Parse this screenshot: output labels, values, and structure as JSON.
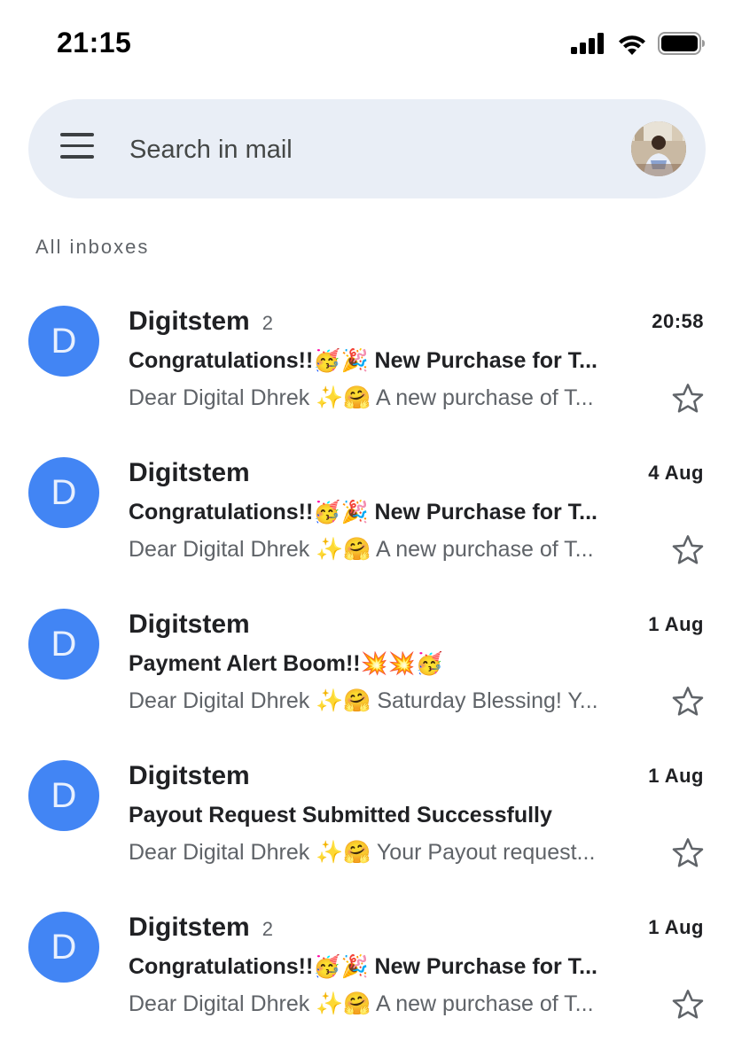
{
  "status": {
    "time": "21:15"
  },
  "search": {
    "placeholder": "Search in mail"
  },
  "section_label": "All inboxes",
  "icons": {
    "menu": "menu-icon",
    "star": "star-icon",
    "signal": "signal-icon",
    "wifi": "wifi-icon",
    "battery": "battery-icon"
  },
  "colors": {
    "avatar_bg": "#4285f4",
    "search_bg": "#e9eef6"
  },
  "emails": [
    {
      "initial": "D",
      "sender": "Digitstem",
      "count": "2",
      "time": "20:58",
      "subject": "Congratulations!!🥳🎉 New Purchase for T...",
      "snippet": "Dear Digital Dhrek ✨🤗 A new purchase of T..."
    },
    {
      "initial": "D",
      "sender": "Digitstem",
      "count": "",
      "time": "4 Aug",
      "subject": "Congratulations!!🥳🎉 New Purchase for T...",
      "snippet": "Dear Digital Dhrek ✨🤗 A new purchase of T..."
    },
    {
      "initial": "D",
      "sender": "Digitstem",
      "count": "",
      "time": "1 Aug",
      "subject": "Payment Alert Boom!!💥💥🥳",
      "snippet": "Dear Digital Dhrek ✨🤗 Saturday Blessing! Y..."
    },
    {
      "initial": "D",
      "sender": "Digitstem",
      "count": "",
      "time": "1 Aug",
      "subject": "Payout Request Submitted Successfully",
      "snippet": "Dear Digital Dhrek ✨🤗 Your Payout request..."
    },
    {
      "initial": "D",
      "sender": "Digitstem",
      "count": "2",
      "time": "1 Aug",
      "subject": "Congratulations!!🥳🎉 New Purchase for T...",
      "snippet": "Dear Digital Dhrek ✨🤗 A new purchase of T..."
    }
  ]
}
